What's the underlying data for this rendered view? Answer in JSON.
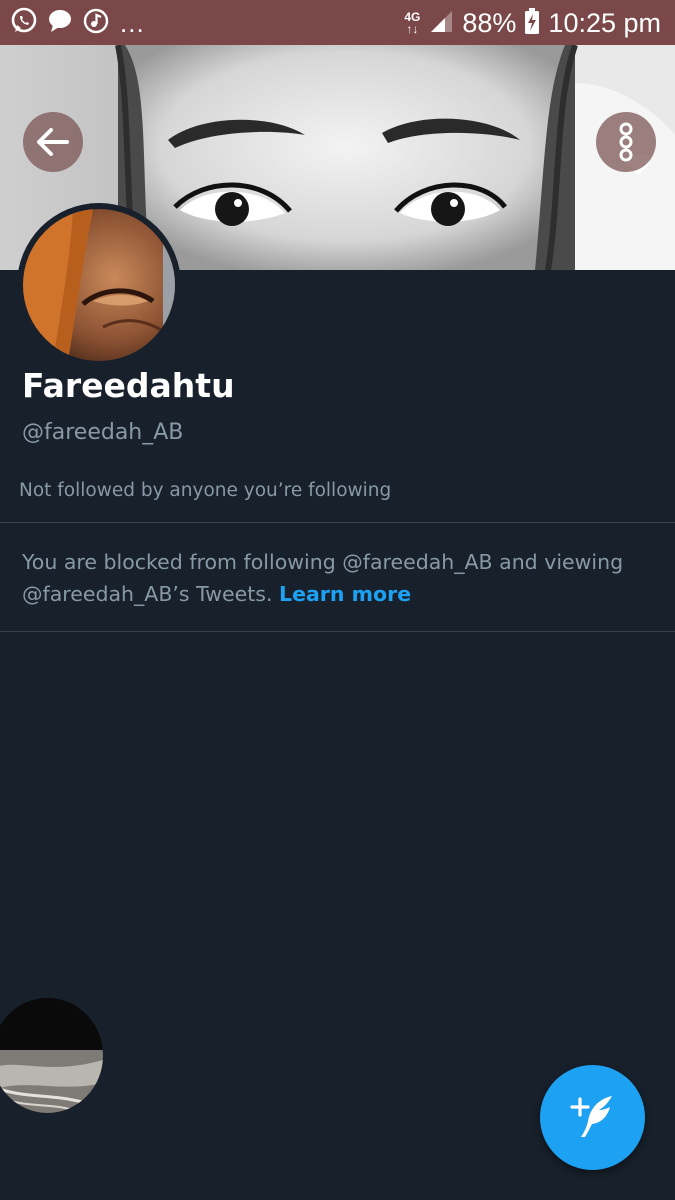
{
  "status_bar": {
    "network_label_top": "4G",
    "network_label_bottom": "↑↓",
    "battery_percent": "88%",
    "time": "10:25 pm",
    "ellipsis": "...",
    "notification_icons": [
      "whatsapp-icon",
      "chat-bubble-icon",
      "music-sync-icon"
    ],
    "background_color": "#7a4848"
  },
  "header": {
    "back_icon": "arrow-left-icon",
    "more_icon": "more-vertical-icon"
  },
  "profile": {
    "display_name": "Fareedahtu",
    "handle": "@fareedah_AB",
    "followed_by_note": "Not followed by anyone you’re following"
  },
  "blocked_notice": {
    "text": "You are blocked from following @fareedah_AB and viewing @fareedah_AB’s Tweets.",
    "link_label": "Learn more",
    "link_color": "#1da1f2"
  },
  "fab": {
    "icon": "compose-tweet-icon",
    "color": "#1da1f2"
  },
  "colors": {
    "background": "#17202b",
    "secondary_text": "#8899a6",
    "divider": "#38444d"
  }
}
